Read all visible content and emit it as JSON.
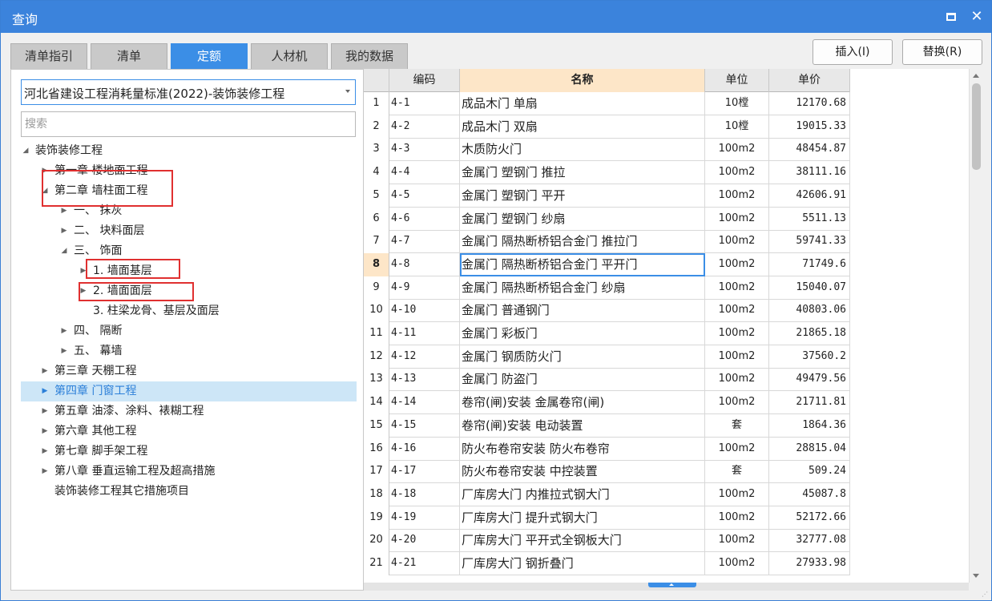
{
  "window": {
    "title": "查询"
  },
  "tabs": [
    {
      "label": "清单指引"
    },
    {
      "label": "清单"
    },
    {
      "label": "定额",
      "active": true
    },
    {
      "label": "人材机"
    },
    {
      "label": "我的数据"
    }
  ],
  "actions": {
    "insert_label": "插入(I)",
    "replace_label": "替换(R)"
  },
  "library": {
    "selected": "河北省建设工程消耗量标准(2022)-装饰装修工程"
  },
  "search": {
    "placeholder": "搜索",
    "value": ""
  },
  "tree": [
    {
      "label": "装饰装修工程",
      "indent": 0,
      "toggle": "expanded"
    },
    {
      "label": "第一章 楼地面工程",
      "indent": 1,
      "toggle": "collapsed"
    },
    {
      "label": "第二章 墙柱面工程",
      "indent": 1,
      "toggle": "expanded"
    },
    {
      "label": "一、 抹灰",
      "indent": 2,
      "toggle": "collapsed"
    },
    {
      "label": "二、 块料面层",
      "indent": 2,
      "toggle": "collapsed"
    },
    {
      "label": "三、 饰面",
      "indent": 2,
      "toggle": "expanded"
    },
    {
      "label": "1. 墙面基层",
      "indent": 3,
      "toggle": "collapsed"
    },
    {
      "label": "2. 墙面面层",
      "indent": 3,
      "toggle": "collapsed"
    },
    {
      "label": "3. 柱梁龙骨、基层及面层",
      "indent": 3,
      "toggle": "none"
    },
    {
      "label": "四、 隔断",
      "indent": 2,
      "toggle": "collapsed"
    },
    {
      "label": "五、 幕墙",
      "indent": 2,
      "toggle": "collapsed"
    },
    {
      "label": "第三章 天棚工程",
      "indent": 1,
      "toggle": "collapsed"
    },
    {
      "label": "第四章 门窗工程",
      "indent": 1,
      "toggle": "collapsed",
      "selected": true
    },
    {
      "label": "第五章 油漆、涂料、裱糊工程",
      "indent": 1,
      "toggle": "collapsed"
    },
    {
      "label": "第六章 其他工程",
      "indent": 1,
      "toggle": "collapsed"
    },
    {
      "label": "第七章 脚手架工程",
      "indent": 1,
      "toggle": "collapsed"
    },
    {
      "label": "第八章 垂直运输工程及超高措施",
      "indent": 1,
      "toggle": "collapsed"
    },
    {
      "label": "装饰装修工程其它措施项目",
      "indent": 1,
      "toggle": "none"
    }
  ],
  "grid": {
    "columns": {
      "code": "编码",
      "name": "名称",
      "unit": "单位",
      "price": "单价"
    },
    "active_row": 8,
    "rows": [
      {
        "no": "1",
        "code": "4-1",
        "name": "成品木门 单扇",
        "unit": "10樘",
        "price": "12170.68"
      },
      {
        "no": "2",
        "code": "4-2",
        "name": "成品木门 双扇",
        "unit": "10樘",
        "price": "19015.33"
      },
      {
        "no": "3",
        "code": "4-3",
        "name": "木质防火门",
        "unit": "100m2",
        "price": "48454.87"
      },
      {
        "no": "4",
        "code": "4-4",
        "name": "金属门 塑钢门 推拉",
        "unit": "100m2",
        "price": "38111.16"
      },
      {
        "no": "5",
        "code": "4-5",
        "name": "金属门 塑钢门 平开",
        "unit": "100m2",
        "price": "42606.91"
      },
      {
        "no": "6",
        "code": "4-6",
        "name": "金属门 塑钢门 纱扇",
        "unit": "100m2",
        "price": "5511.13"
      },
      {
        "no": "7",
        "code": "4-7",
        "name": "金属门 隔热断桥铝合金门 推拉门",
        "unit": "100m2",
        "price": "59741.33"
      },
      {
        "no": "8",
        "code": "4-8",
        "name": "金属门 隔热断桥铝合金门 平开门",
        "unit": "100m2",
        "price": "71749.6"
      },
      {
        "no": "9",
        "code": "4-9",
        "name": "金属门 隔热断桥铝合金门 纱扇",
        "unit": "100m2",
        "price": "15040.07"
      },
      {
        "no": "10",
        "code": "4-10",
        "name": "金属门 普通钢门",
        "unit": "100m2",
        "price": "40803.06"
      },
      {
        "no": "11",
        "code": "4-11",
        "name": "金属门 彩板门",
        "unit": "100m2",
        "price": "21865.18"
      },
      {
        "no": "12",
        "code": "4-12",
        "name": "金属门 钢质防火门",
        "unit": "100m2",
        "price": "37560.2"
      },
      {
        "no": "13",
        "code": "4-13",
        "name": "金属门 防盗门",
        "unit": "100m2",
        "price": "49479.56"
      },
      {
        "no": "14",
        "code": "4-14",
        "name": "卷帘(闸)安装 金属卷帘(闸)",
        "unit": "100m2",
        "price": "21711.81"
      },
      {
        "no": "15",
        "code": "4-15",
        "name": "卷帘(闸)安装 电动装置",
        "unit": "套",
        "price": "1864.36"
      },
      {
        "no": "16",
        "code": "4-16",
        "name": "防火布卷帘安装 防火布卷帘",
        "unit": "100m2",
        "price": "28815.04"
      },
      {
        "no": "17",
        "code": "4-17",
        "name": "防火布卷帘安装 中控装置",
        "unit": "套",
        "price": "509.24"
      },
      {
        "no": "18",
        "code": "4-18",
        "name": "厂库房大门 内推拉式钢大门",
        "unit": "100m2",
        "price": "45087.8"
      },
      {
        "no": "19",
        "code": "4-19",
        "name": "厂库房大门 提升式钢大门",
        "unit": "100m2",
        "price": "52172.66"
      },
      {
        "no": "20",
        "code": "4-20",
        "name": "厂库房大门 平开式全钢板大门",
        "unit": "100m2",
        "price": "32777.08"
      },
      {
        "no": "21",
        "code": "4-21",
        "name": "厂库房大门 钢折叠门",
        "unit": "100m2",
        "price": "27933.98"
      }
    ]
  }
}
